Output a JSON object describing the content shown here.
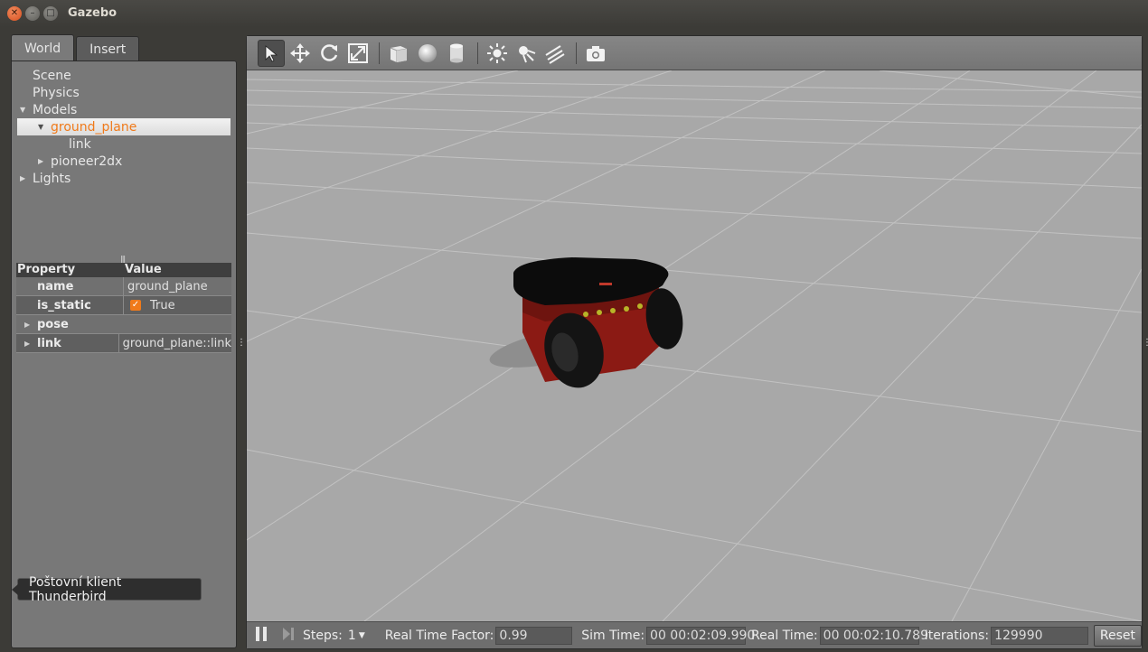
{
  "window": {
    "title": "Gazebo"
  },
  "left": {
    "tabs": [
      {
        "label": "World"
      },
      {
        "label": "Insert"
      }
    ],
    "tree": {
      "scene": "Scene",
      "physics": "Physics",
      "models": "Models",
      "ground_plane": "ground_plane",
      "link": "link",
      "pioneer": "pioneer2dx",
      "lights": "Lights"
    },
    "properties": {
      "header_property": "Property",
      "header_value": "Value",
      "rows": [
        {
          "name": "name",
          "value": "ground_plane"
        },
        {
          "name": "is_static",
          "value": "True"
        },
        {
          "name": "pose",
          "value": ""
        },
        {
          "name": "link",
          "value": "ground_plane::link"
        }
      ]
    },
    "tooltip": "Poštovní klient Thunderbird"
  },
  "toolbar": {
    "icons": [
      "select-icon",
      "translate-icon",
      "rotate-icon",
      "scale-icon",
      "box-icon",
      "sphere-icon",
      "cylinder-icon",
      "point-light-icon",
      "spot-light-icon",
      "directional-light-icon",
      "screenshot-icon"
    ]
  },
  "bottom": {
    "steps_label": "Steps:",
    "steps_value": "1",
    "rtf_label": "Real Time Factor:",
    "rtf_value": "0.99",
    "sim_label": "Sim Time:",
    "sim_value": "00 00:02:09.990",
    "real_label": "Real Time:",
    "real_value": "00 00:02:10.789",
    "iter_label": "Iterations:",
    "iter_value": "129990",
    "reset_label": "Reset"
  },
  "colors": {
    "accent": "#f07a1a",
    "robot_body": "#8b1a14",
    "ground": "#a7a7a7"
  }
}
